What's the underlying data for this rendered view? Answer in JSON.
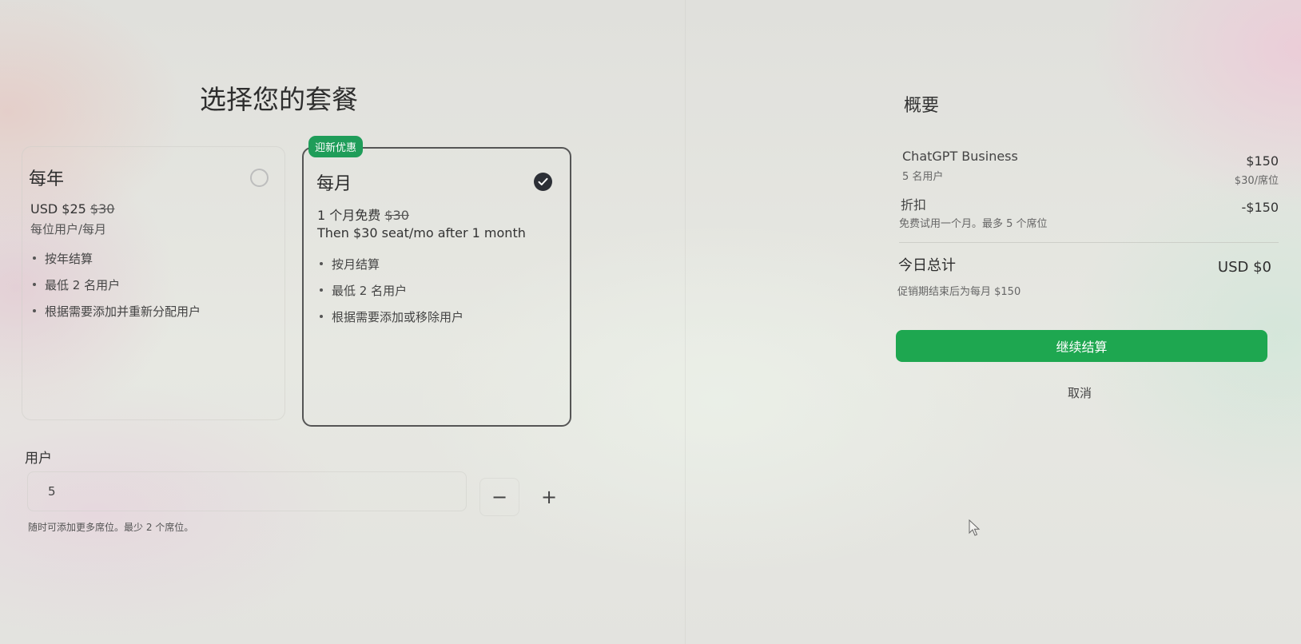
{
  "page": {
    "title": "选择您的套餐"
  },
  "plans": {
    "yearly": {
      "name": "每年",
      "price": "USD $25",
      "price_strike": "$30",
      "price_sub": "每位用户/每月",
      "features": [
        "按年结算",
        "最低 2 名用户",
        "根据需要添加并重新分配用户"
      ],
      "selected": false
    },
    "monthly": {
      "badge": "迎新优惠",
      "name": "每月",
      "price": "1 个月免费",
      "price_strike": "$30",
      "price_sub": "Then $30 seat/mo after 1 month",
      "features": [
        "按月结算",
        "最低 2 名用户",
        "根据需要添加或移除用户"
      ],
      "selected": true
    }
  },
  "users": {
    "label": "用户",
    "value": "5",
    "minus": "−",
    "plus": "+",
    "hint": "随时可添加更多席位。最少 2 个席位。"
  },
  "summary": {
    "title": "概要",
    "product": {
      "name": "ChatGPT Business",
      "sub": "5 名用户",
      "price": "$150",
      "unit": "$30/席位"
    },
    "discount": {
      "label": "折扣",
      "sub": "免费试用一个月。最多 5 个席位",
      "value": "-$150"
    },
    "total": {
      "label": "今日总计",
      "value": "USD $0",
      "sub": "促销期结束后为每月 $150"
    },
    "checkout_label": "继续结算",
    "cancel_label": "取消"
  },
  "colors": {
    "accent": "#1ea750",
    "badge": "#1f9d59",
    "check": "#2c2f36"
  }
}
